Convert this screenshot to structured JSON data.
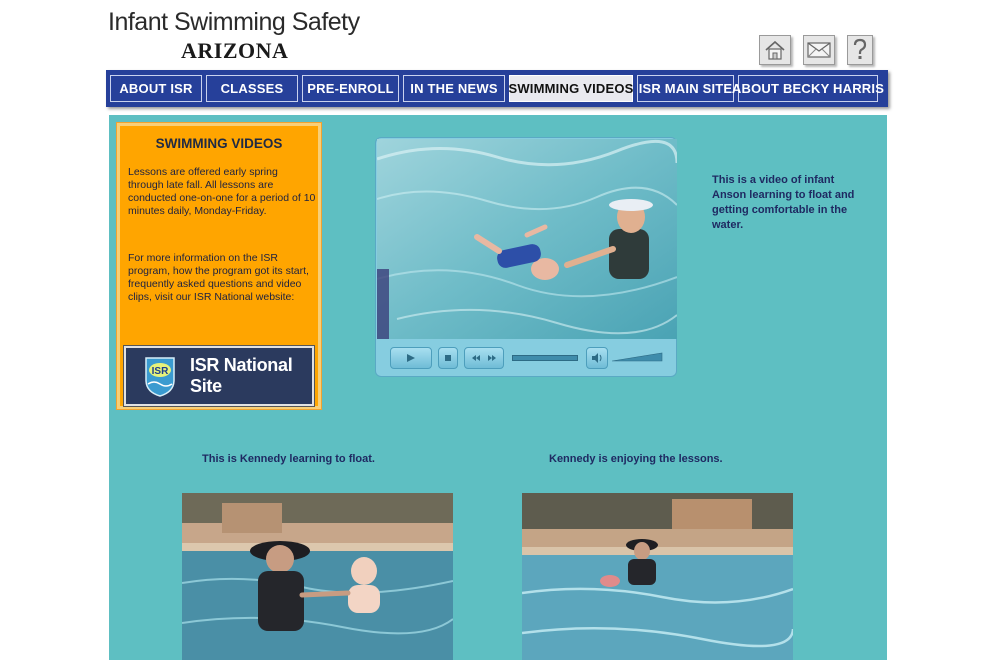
{
  "header": {
    "title": "Infant Swimming Safety",
    "subtitle": "ARIZONA",
    "icons": [
      "home-icon",
      "mail-icon",
      "help-icon"
    ]
  },
  "nav": {
    "items": [
      {
        "label": "ABOUT ISR"
      },
      {
        "label": "CLASSES"
      },
      {
        "label": "PRE-ENROLL"
      },
      {
        "label": "IN THE NEWS"
      },
      {
        "label": "SWIMMING VIDEOS",
        "active": true
      },
      {
        "label": "ISR MAIN SITE"
      },
      {
        "label": "ABOUT BECKY HARRIS"
      }
    ]
  },
  "sidebar": {
    "title": "SWIMMING VIDEOS",
    "paragraph1": "Lessons are offered early spring through late fall. All lessons are conducted one-on-one for a period of 10 minutes daily, Monday-Friday.",
    "paragraph2": "For more information on the ISR program, how the program got its start, frequently asked questions and video clips, visit our ISR National website:",
    "banner_label": "ISR National Site",
    "logo_text": "ISR"
  },
  "videos": {
    "main_caption": "This is a video of infant Anson learning to float and getting comfortable in the water.",
    "caption_left": "This is Kennedy learning to float.",
    "caption_right": "Kennedy is enjoying the lessons."
  },
  "colors": {
    "nav_bg": "#26409a",
    "panel_bg": "#5ebfc2",
    "sidebar_bg": "#ffa500",
    "caption_text": "#1f2a62"
  }
}
